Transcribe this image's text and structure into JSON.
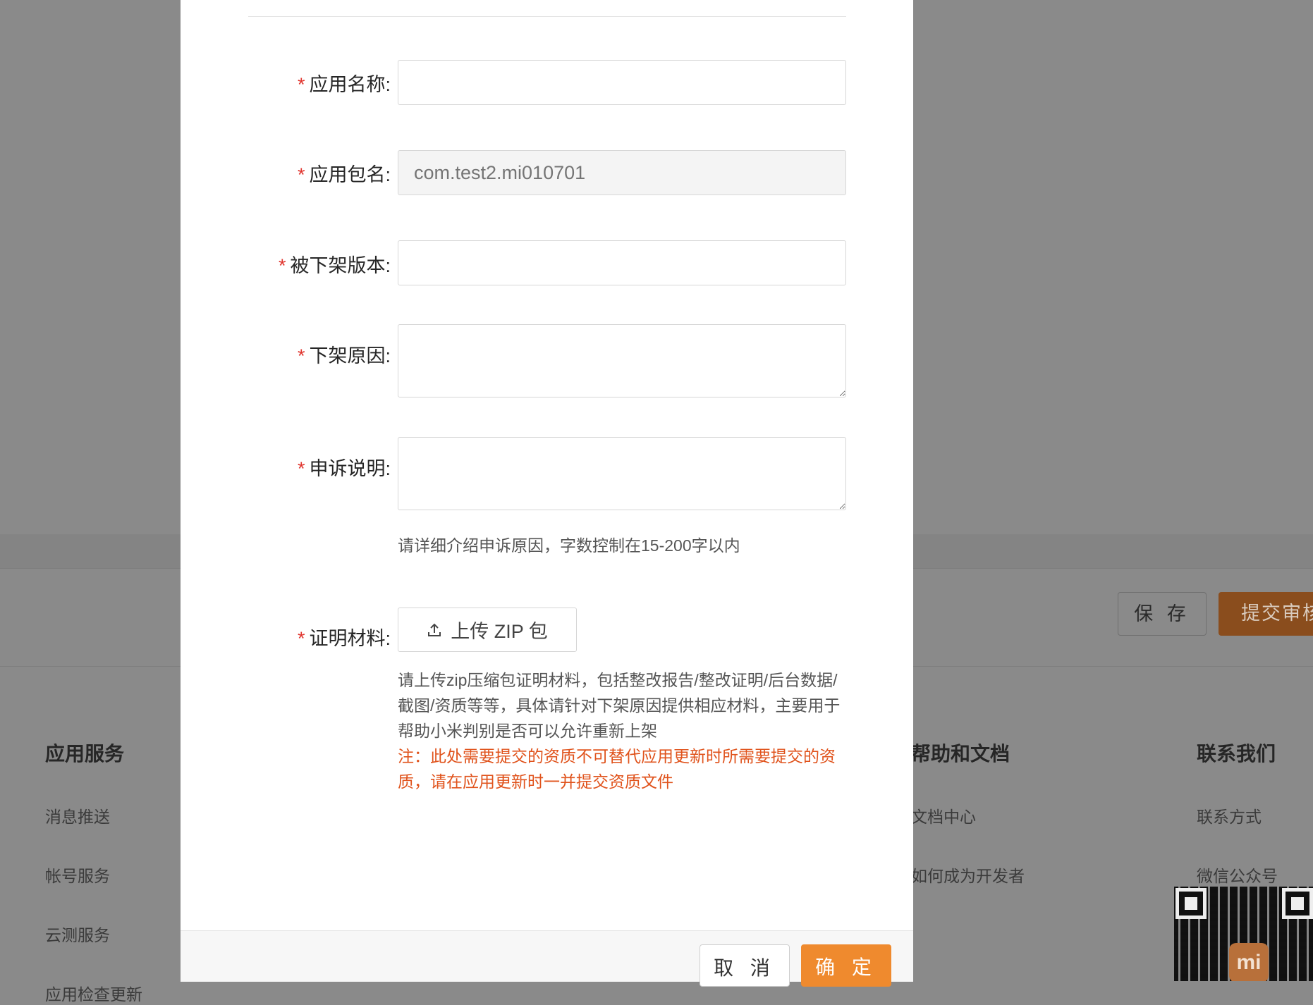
{
  "background": {
    "buttons": {
      "save": "保 存",
      "submit": "提交审核"
    },
    "footer": {
      "columns": [
        {
          "title": "应用服务",
          "links": [
            "消息推送",
            "帐号服务",
            "云测服务",
            "应用检查更新"
          ]
        },
        {
          "title": "帮助和文档",
          "links": [
            "文档中心",
            "如何成为开发者"
          ]
        },
        {
          "title": "联系我们",
          "links": [
            "联系方式",
            "微信公众号"
          ]
        }
      ],
      "qr_logo": "mi"
    }
  },
  "form": {
    "required_mark": "*",
    "app_name": {
      "label": "应用名称:",
      "value": ""
    },
    "package_name": {
      "label": "应用包名:",
      "placeholder": "com.test2.mi010701"
    },
    "removed_version": {
      "label": "被下架版本:",
      "value": ""
    },
    "removal_reason": {
      "label": "下架原因:",
      "value": ""
    },
    "appeal_note": {
      "label": "申诉说明:",
      "value": "",
      "hint": "请详细介绍申诉原因，字数控制在15-200字以内"
    },
    "proof": {
      "label": "证明材料:",
      "upload_button": "上传 ZIP 包",
      "upload_icon": "upload-icon",
      "description": "请上传zip压缩包证明材料，包括整改报告/整改证明/后台数据/截图/资质等等，具体请针对下架原因提供相应材料，主要用于帮助小米判别是否可以允许重新上架",
      "note": "注：此处需要提交的资质不可替代应用更新时所需要提交的资质，请在应用更新时一并提交资质文件"
    }
  },
  "dialog_buttons": {
    "cancel": "取 消",
    "confirm": "确 定"
  },
  "colors": {
    "required": "#e0332c",
    "accent": "#ef8a2e",
    "note": "#e0531c"
  }
}
